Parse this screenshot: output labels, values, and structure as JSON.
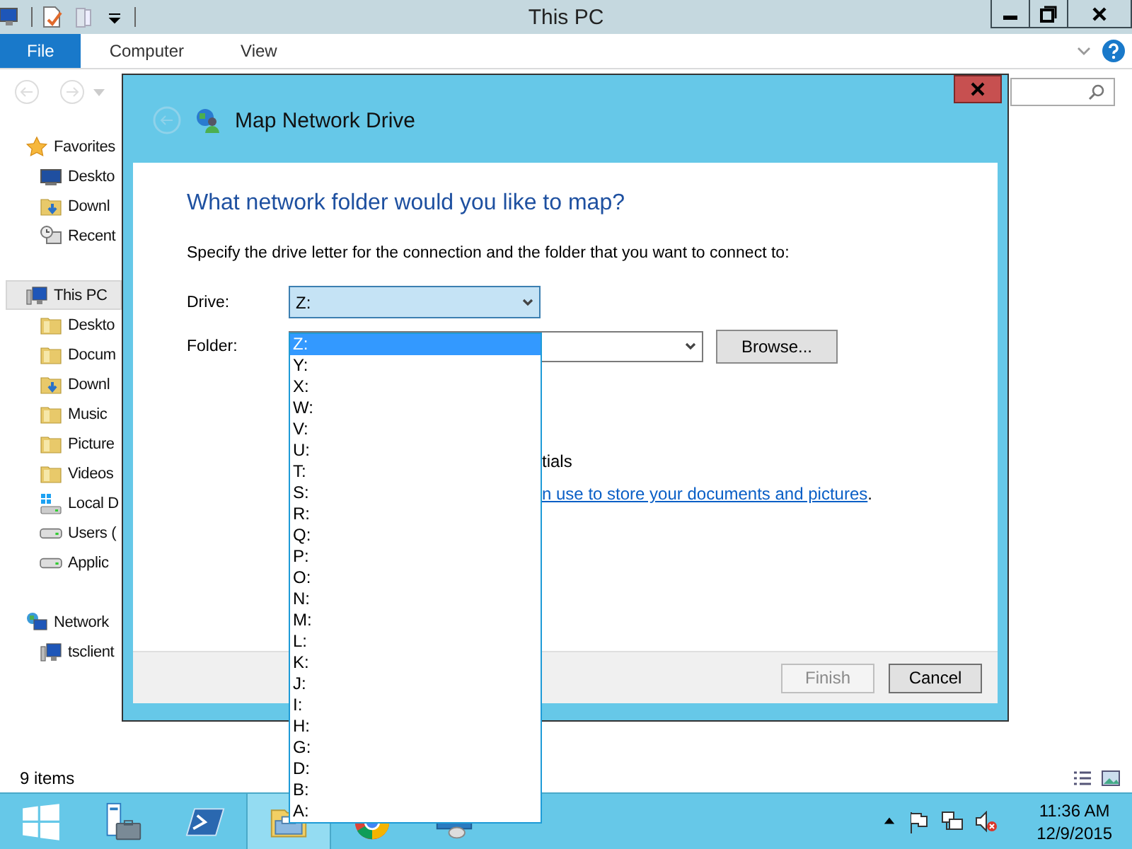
{
  "explorer": {
    "title": "This PC",
    "ribbon_tabs": [
      {
        "label": "File",
        "selected": true
      },
      {
        "label": "Computer",
        "selected": false
      },
      {
        "label": "View",
        "selected": false
      }
    ],
    "sidebar": [
      {
        "label": "Favorites",
        "kind": "star",
        "selected": false,
        "children": [
          {
            "label": "Deskto",
            "kind": "desktop",
            "selected": false
          },
          {
            "label": "Downl",
            "kind": "downloads",
            "selected": false
          },
          {
            "label": "Recent",
            "kind": "recent",
            "selected": false
          }
        ]
      },
      {
        "label": "This PC",
        "kind": "pc",
        "selected": true,
        "children": [
          {
            "label": "Deskto",
            "kind": "folder",
            "selected": false
          },
          {
            "label": "Docum",
            "kind": "folder",
            "selected": false
          },
          {
            "label": "Downl",
            "kind": "downloads",
            "selected": false
          },
          {
            "label": "Music",
            "kind": "folder",
            "selected": false
          },
          {
            "label": "Picture",
            "kind": "folder",
            "selected": false
          },
          {
            "label": "Videos",
            "kind": "folder",
            "selected": false
          },
          {
            "label": "Local D",
            "kind": "windisk",
            "selected": false
          },
          {
            "label": "Users (",
            "kind": "disk",
            "selected": false
          },
          {
            "label": "Applic",
            "kind": "disk",
            "selected": false
          }
        ]
      },
      {
        "label": "Network",
        "kind": "network",
        "selected": false,
        "children": [
          {
            "label": "tsclient",
            "kind": "pc",
            "selected": false
          }
        ]
      }
    ],
    "status_bar": {
      "item_count": "9 items"
    }
  },
  "dialog": {
    "title": "Map Network Drive",
    "heading": "What network folder would you like to map?",
    "instruction": "Specify the drive letter for the connection and the folder that you want to connect to:",
    "drive": {
      "label": "Drive:",
      "value": "Z:"
    },
    "folder": {
      "label": "Folder:"
    },
    "browse_button": "Browse...",
    "partial_text": "tials",
    "link": "n use to store your documents and pictures",
    "link_suffix": ".",
    "buttons": [
      {
        "label": "Finish",
        "disabled": true
      },
      {
        "label": "Cancel",
        "disabled": false
      }
    ]
  },
  "drive_options": [
    {
      "label": "Z:",
      "selected": true
    },
    {
      "label": "Y:",
      "selected": false
    },
    {
      "label": "X:",
      "selected": false
    },
    {
      "label": "W:",
      "selected": false
    },
    {
      "label": "V:",
      "selected": false
    },
    {
      "label": "U:",
      "selected": false
    },
    {
      "label": "T:",
      "selected": false
    },
    {
      "label": "S:",
      "selected": false
    },
    {
      "label": "R:",
      "selected": false
    },
    {
      "label": "Q:",
      "selected": false
    },
    {
      "label": "P:",
      "selected": false
    },
    {
      "label": "O:",
      "selected": false
    },
    {
      "label": "N:",
      "selected": false
    },
    {
      "label": "M:",
      "selected": false
    },
    {
      "label": "L:",
      "selected": false
    },
    {
      "label": "K:",
      "selected": false
    },
    {
      "label": "J:",
      "selected": false
    },
    {
      "label": "I:",
      "selected": false
    },
    {
      "label": "H:",
      "selected": false
    },
    {
      "label": "G:",
      "selected": false
    },
    {
      "label": "D:",
      "selected": false
    },
    {
      "label": "B:",
      "selected": false
    },
    {
      "label": "A:",
      "selected": false
    }
  ],
  "taskbar": {
    "apps": [
      {
        "kind": "start",
        "active": false
      },
      {
        "kind": "server",
        "active": false
      },
      {
        "kind": "powershell",
        "active": false
      },
      {
        "kind": "explorer",
        "active": true
      },
      {
        "kind": "chrome",
        "active": false
      },
      {
        "kind": "remote",
        "active": false
      }
    ],
    "tray": [
      {
        "kind": "arrow"
      },
      {
        "kind": "flag"
      },
      {
        "kind": "network"
      },
      {
        "kind": "speaker-muted"
      }
    ],
    "clock": {
      "time": "11:36 AM",
      "date": "12/9/2015"
    }
  }
}
